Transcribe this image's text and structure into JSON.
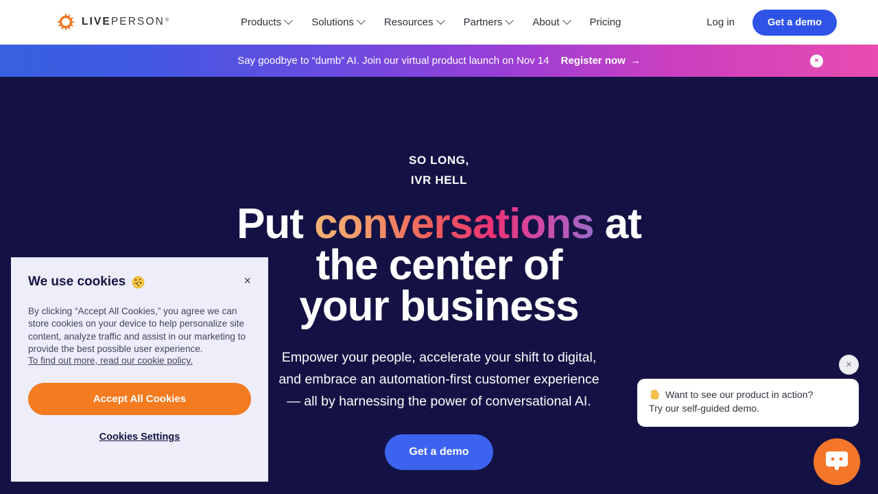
{
  "nav": {
    "logo": {
      "icon": "liveperson-sun-icon",
      "bold_part": "LIVE",
      "light_part": "PERSON",
      "registered": "®"
    },
    "links": [
      {
        "label": "Products",
        "has_dropdown": true
      },
      {
        "label": "Solutions",
        "has_dropdown": true
      },
      {
        "label": "Resources",
        "has_dropdown": true
      },
      {
        "label": "Partners",
        "has_dropdown": true
      },
      {
        "label": "About",
        "has_dropdown": true
      },
      {
        "label": "Pricing",
        "has_dropdown": false
      }
    ],
    "login_label": "Log in",
    "demo_label": "Get a demo",
    "demo_color": "#2f53e6"
  },
  "banner": {
    "message": "Say goodbye to “dumb” AI. Join our virtual product launch on Nov 14",
    "cta_label": "Register now",
    "cta_arrow": "→",
    "close_label": "×",
    "gradient_start": "#3761e0",
    "gradient_end": "#e84cb0"
  },
  "hero": {
    "background": "#141244",
    "eyebrow_line1": "SO LONG,",
    "eyebrow_line2": "IVR HELL",
    "headline_part1": "Put ",
    "headline_gradient_word": "conversations",
    "headline_part2": " at",
    "headline_line2": "the center of",
    "headline_line3": "your business",
    "gradient_from": "#f5b474",
    "gradient_mid": "#ec3277",
    "gradient_to": "#9b6bc8",
    "subhead_line1": "Empower your people, accelerate your shift to digital,",
    "subhead_line2": "and embrace an automation-first customer experience",
    "subhead_line3": "— all by harnessing the power of conversational AI.",
    "cta_label": "Get a demo",
    "cta_color": "#3b63ef"
  },
  "cookie_dialog": {
    "title": "We use cookies",
    "emoji": "cookie-emoji",
    "close_label": "×",
    "body": "By clicking “Accept All Cookies,” you agree we can store cookies on your device to help personalize site content, analyze traffic and assist in our marketing to provide the best possible user experience.",
    "policy_link": "To find out more, read our cookie policy.",
    "accept_label": "Accept All Cookies",
    "accept_color": "#f47b20",
    "settings_label": "Cookies Settings",
    "background": "#eeeefb"
  },
  "chat_widget": {
    "close_label": "×",
    "message_line1": "Want to see our product in action?",
    "message_line2": "Try our self-guided demo.",
    "emoji": "waving-hand-emoji",
    "launcher_icon": "chat-bot-icon",
    "launcher_color": "#f4762a"
  }
}
